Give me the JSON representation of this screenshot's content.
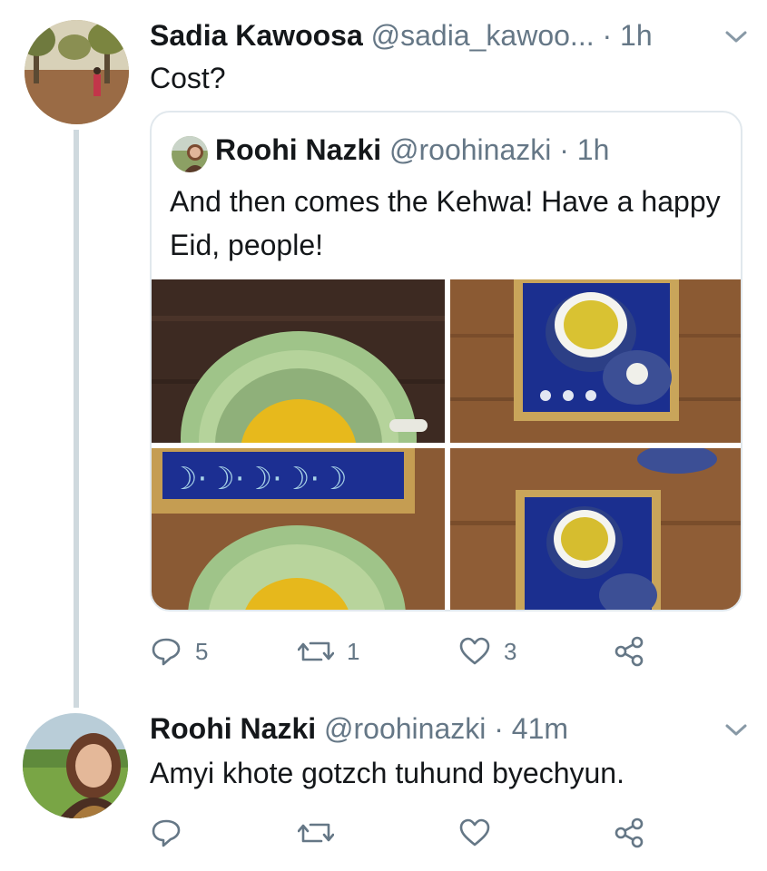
{
  "tweets": [
    {
      "name": "Sadia Kawoosa",
      "handle": "@sadia_kawoo...",
      "dot": "·",
      "time": "1h",
      "text": "Cost?",
      "avatar_icon": "avatar-photo",
      "menu_icon": "chevron-down-icon",
      "quote": {
        "name": "Roohi Nazki",
        "handle": "@roohinazki",
        "dot": "·",
        "time": "1h",
        "text": "And then comes the Kehwa! Have a happy Eid, people!",
        "photos": [
          "kehwa-cup-closeup",
          "kehwa-tray-top-view",
          "moon-tray-and-cup",
          "kehwa-tray-side-view"
        ]
      },
      "actions": {
        "reply": "5",
        "retweet": "1",
        "like": "3"
      }
    },
    {
      "name": "Roohi Nazki",
      "handle": "@roohinazki",
      "dot": "·",
      "time": "41m",
      "text": "Amyi khote gotzch tuhund byechyun.",
      "avatar_icon": "avatar-photo",
      "menu_icon": "chevron-down-icon",
      "actions": {
        "reply": "",
        "retweet": "",
        "like": ""
      }
    }
  ],
  "colors": {
    "text": "#14171a",
    "secondary": "#657786",
    "border": "#e1e8ed",
    "thread_line": "#cfd9de"
  }
}
